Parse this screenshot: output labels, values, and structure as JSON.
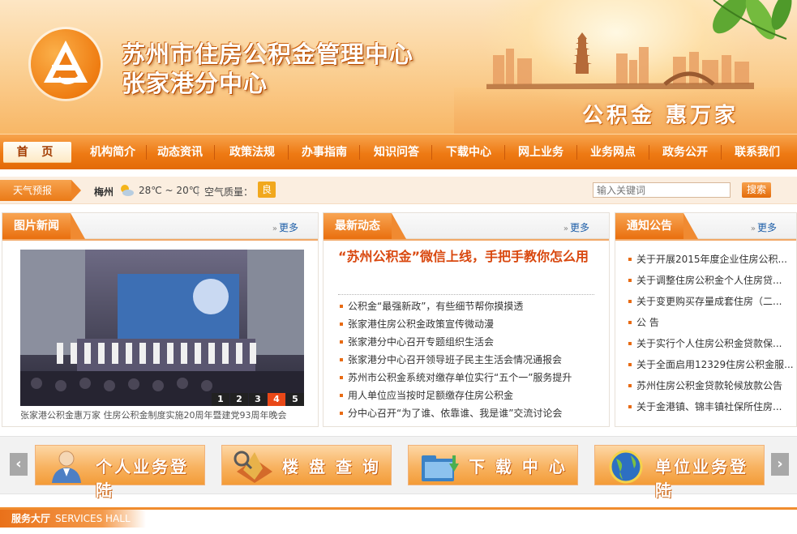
{
  "header": {
    "title_line1": "苏州市住房公积金管理中心",
    "title_line2": "张家港分中心",
    "slogan": "公积金  惠万家"
  },
  "nav": {
    "items": [
      "首 页",
      "机构简介",
      "动态资讯",
      "政策法规",
      "办事指南",
      "知识问答",
      "下载中心",
      "网上业务",
      "业务网点",
      "政务公开",
      "联系我们"
    ]
  },
  "weather": {
    "tag": "天气预报",
    "city": "梅州",
    "temp": "28℃ ~ 20℃",
    "separator": "|",
    "aq_label": "空气质量：",
    "aq_value": "良"
  },
  "search": {
    "placeholder": "输入关键词",
    "button": "搜索"
  },
  "photo_news": {
    "title": "图片新闻",
    "more": "更多",
    "caption": "张家港公积金惠万家 住房公积金制度实施20周年暨建党93周年晚会",
    "pages": [
      "1",
      "2",
      "3",
      "4",
      "5"
    ],
    "active_page": "4"
  },
  "latest": {
    "title": "最新动态",
    "more": "更多",
    "headline": "“苏州公积金”微信上线，手把手教你怎么用",
    "items": [
      "公积金“最强新政”，有些细节帮你摸摸透",
      "张家港住房公积金政策宣传微动漫",
      "张家港分中心召开专题组织生活会",
      "张家港分中心召开领导班子民主生活会情况通报会",
      "苏州市公积金系统对缴存单位实行“五个一”服务提升",
      "用人单位应当按时足额缴存住房公积金",
      "分中心召开“为了谁、依靠谁、我是谁”交流讨论会"
    ]
  },
  "notices": {
    "title": "通知公告",
    "more": "更多",
    "items": [
      "关于开展2015年度企业住房公积...",
      "关于调整住房公积金个人住房贷...",
      "关于变更购买存量成套住房（二...",
      "公 告",
      "关于实行个人住房公积金贷款保...",
      "关于全面启用12329住房公积金服...",
      "苏州住房公积金贷款轮候放款公告",
      "关于金港镇、锦丰镇社保所住房..."
    ]
  },
  "quick_links": {
    "prev": "‹",
    "next": "›",
    "items": [
      "个人业务登陆",
      "楼 盘 查 询",
      "下 载 中 心",
      "单位业务登陆"
    ]
  },
  "service_hall": {
    "title_cn": "服务大厅",
    "title_en": "SERVICES HALL"
  },
  "colors": {
    "accent": "#ee7a14",
    "headline": "#d9480f",
    "link_blue": "#1d5ea8"
  }
}
